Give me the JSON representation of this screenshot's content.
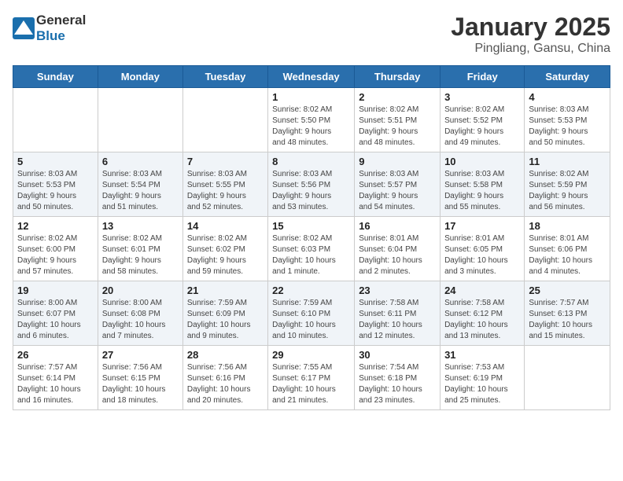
{
  "header": {
    "logo_general": "General",
    "logo_blue": "Blue",
    "title": "January 2025",
    "subtitle": "Pingliang, Gansu, China"
  },
  "weekdays": [
    "Sunday",
    "Monday",
    "Tuesday",
    "Wednesday",
    "Thursday",
    "Friday",
    "Saturday"
  ],
  "weeks": [
    [
      {
        "day": "",
        "info": ""
      },
      {
        "day": "",
        "info": ""
      },
      {
        "day": "",
        "info": ""
      },
      {
        "day": "1",
        "info": "Sunrise: 8:02 AM\nSunset: 5:50 PM\nDaylight: 9 hours\nand 48 minutes."
      },
      {
        "day": "2",
        "info": "Sunrise: 8:02 AM\nSunset: 5:51 PM\nDaylight: 9 hours\nand 48 minutes."
      },
      {
        "day": "3",
        "info": "Sunrise: 8:02 AM\nSunset: 5:52 PM\nDaylight: 9 hours\nand 49 minutes."
      },
      {
        "day": "4",
        "info": "Sunrise: 8:03 AM\nSunset: 5:53 PM\nDaylight: 9 hours\nand 50 minutes."
      }
    ],
    [
      {
        "day": "5",
        "info": "Sunrise: 8:03 AM\nSunset: 5:53 PM\nDaylight: 9 hours\nand 50 minutes."
      },
      {
        "day": "6",
        "info": "Sunrise: 8:03 AM\nSunset: 5:54 PM\nDaylight: 9 hours\nand 51 minutes."
      },
      {
        "day": "7",
        "info": "Sunrise: 8:03 AM\nSunset: 5:55 PM\nDaylight: 9 hours\nand 52 minutes."
      },
      {
        "day": "8",
        "info": "Sunrise: 8:03 AM\nSunset: 5:56 PM\nDaylight: 9 hours\nand 53 minutes."
      },
      {
        "day": "9",
        "info": "Sunrise: 8:03 AM\nSunset: 5:57 PM\nDaylight: 9 hours\nand 54 minutes."
      },
      {
        "day": "10",
        "info": "Sunrise: 8:03 AM\nSunset: 5:58 PM\nDaylight: 9 hours\nand 55 minutes."
      },
      {
        "day": "11",
        "info": "Sunrise: 8:02 AM\nSunset: 5:59 PM\nDaylight: 9 hours\nand 56 minutes."
      }
    ],
    [
      {
        "day": "12",
        "info": "Sunrise: 8:02 AM\nSunset: 6:00 PM\nDaylight: 9 hours\nand 57 minutes."
      },
      {
        "day": "13",
        "info": "Sunrise: 8:02 AM\nSunset: 6:01 PM\nDaylight: 9 hours\nand 58 minutes."
      },
      {
        "day": "14",
        "info": "Sunrise: 8:02 AM\nSunset: 6:02 PM\nDaylight: 9 hours\nand 59 minutes."
      },
      {
        "day": "15",
        "info": "Sunrise: 8:02 AM\nSunset: 6:03 PM\nDaylight: 10 hours\nand 1 minute."
      },
      {
        "day": "16",
        "info": "Sunrise: 8:01 AM\nSunset: 6:04 PM\nDaylight: 10 hours\nand 2 minutes."
      },
      {
        "day": "17",
        "info": "Sunrise: 8:01 AM\nSunset: 6:05 PM\nDaylight: 10 hours\nand 3 minutes."
      },
      {
        "day": "18",
        "info": "Sunrise: 8:01 AM\nSunset: 6:06 PM\nDaylight: 10 hours\nand 4 minutes."
      }
    ],
    [
      {
        "day": "19",
        "info": "Sunrise: 8:00 AM\nSunset: 6:07 PM\nDaylight: 10 hours\nand 6 minutes."
      },
      {
        "day": "20",
        "info": "Sunrise: 8:00 AM\nSunset: 6:08 PM\nDaylight: 10 hours\nand 7 minutes."
      },
      {
        "day": "21",
        "info": "Sunrise: 7:59 AM\nSunset: 6:09 PM\nDaylight: 10 hours\nand 9 minutes."
      },
      {
        "day": "22",
        "info": "Sunrise: 7:59 AM\nSunset: 6:10 PM\nDaylight: 10 hours\nand 10 minutes."
      },
      {
        "day": "23",
        "info": "Sunrise: 7:58 AM\nSunset: 6:11 PM\nDaylight: 10 hours\nand 12 minutes."
      },
      {
        "day": "24",
        "info": "Sunrise: 7:58 AM\nSunset: 6:12 PM\nDaylight: 10 hours\nand 13 minutes."
      },
      {
        "day": "25",
        "info": "Sunrise: 7:57 AM\nSunset: 6:13 PM\nDaylight: 10 hours\nand 15 minutes."
      }
    ],
    [
      {
        "day": "26",
        "info": "Sunrise: 7:57 AM\nSunset: 6:14 PM\nDaylight: 10 hours\nand 16 minutes."
      },
      {
        "day": "27",
        "info": "Sunrise: 7:56 AM\nSunset: 6:15 PM\nDaylight: 10 hours\nand 18 minutes."
      },
      {
        "day": "28",
        "info": "Sunrise: 7:56 AM\nSunset: 6:16 PM\nDaylight: 10 hours\nand 20 minutes."
      },
      {
        "day": "29",
        "info": "Sunrise: 7:55 AM\nSunset: 6:17 PM\nDaylight: 10 hours\nand 21 minutes."
      },
      {
        "day": "30",
        "info": "Sunrise: 7:54 AM\nSunset: 6:18 PM\nDaylight: 10 hours\nand 23 minutes."
      },
      {
        "day": "31",
        "info": "Sunrise: 7:53 AM\nSunset: 6:19 PM\nDaylight: 10 hours\nand 25 minutes."
      },
      {
        "day": "",
        "info": ""
      }
    ]
  ]
}
